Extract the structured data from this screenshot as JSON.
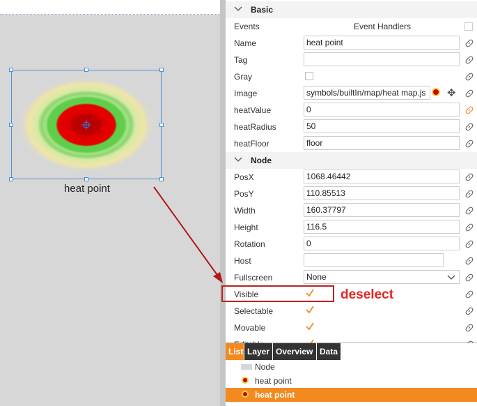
{
  "canvas": {
    "node_label": "heat point"
  },
  "panel": {
    "sections": {
      "basic": "Basic",
      "node": "Node"
    },
    "events_label": "Events",
    "event_handlers_label": "Event Handlers",
    "basic_rows": [
      {
        "label": "Name",
        "value": "heat point"
      },
      {
        "label": "Tag",
        "value": ""
      },
      {
        "label": "Gray",
        "value": ""
      },
      {
        "label": "Image",
        "value": "symbols/builtIn/map/heat map.js"
      },
      {
        "label": "heatValue",
        "value": "0"
      },
      {
        "label": "heatRadius",
        "value": "50"
      },
      {
        "label": "heatFloor",
        "value": "floor"
      }
    ],
    "node_rows": [
      {
        "label": "PosX",
        "value": "1068.46442"
      },
      {
        "label": "PosY",
        "value": "110.85513"
      },
      {
        "label": "Width",
        "value": "160.37797"
      },
      {
        "label": "Height",
        "value": "116.5"
      },
      {
        "label": "Rotation",
        "value": "0"
      },
      {
        "label": "Host",
        "value": ""
      },
      {
        "label": "Fullscreen",
        "value": "None"
      }
    ],
    "check_rows": [
      {
        "label": "Visible",
        "checked": true
      },
      {
        "label": "Selectable",
        "checked": true
      },
      {
        "label": "Movable",
        "checked": true
      },
      {
        "label": "Editable",
        "checked": true
      }
    ]
  },
  "tabs": [
    "List",
    "Layer",
    "Overview",
    "Data"
  ],
  "list": [
    {
      "label": "Node",
      "icon": "node-icon"
    },
    {
      "label": "heat point",
      "icon": "heat-icon"
    },
    {
      "label": "heat point",
      "icon": "heat-icon",
      "selected": true
    }
  ],
  "annotation": {
    "text": "deselect"
  },
  "colors": {
    "accent": "#f28a1f",
    "annotation": "#e52521"
  }
}
